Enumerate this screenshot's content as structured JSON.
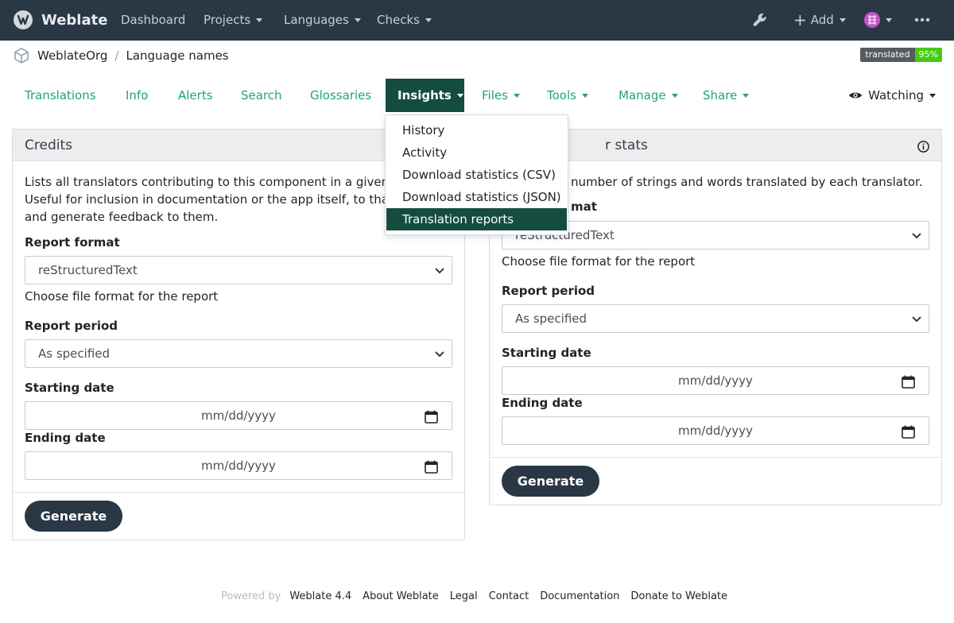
{
  "navbar": {
    "brand": "Weblate",
    "items": [
      {
        "label": "Dashboard"
      },
      {
        "label": "Projects"
      },
      {
        "label": "Languages"
      },
      {
        "label": "Checks"
      }
    ],
    "add_label": "Add"
  },
  "breadcrumb": {
    "project": "WeblateOrg",
    "component": "Language names"
  },
  "badge": {
    "key": "translated",
    "value": "95%"
  },
  "tabs": [
    {
      "label": "Translations"
    },
    {
      "label": "Info"
    },
    {
      "label": "Alerts"
    },
    {
      "label": "Search"
    },
    {
      "label": "Glossaries"
    },
    {
      "label": "Insights"
    },
    {
      "label": "Files"
    },
    {
      "label": "Tools"
    },
    {
      "label": "Manage"
    },
    {
      "label": "Share"
    }
  ],
  "watching_label": "Watching",
  "insights_menu": [
    {
      "label": "History"
    },
    {
      "label": "Activity"
    },
    {
      "label": "Download statistics (CSV)"
    },
    {
      "label": "Download statistics (JSON)"
    },
    {
      "label": "Translation reports"
    }
  ],
  "credits": {
    "title": "Credits",
    "description_lines": [
      "Lists all translators contributing to this component in a given tim",
      "Useful for inclusion in documentation or the app itself, to thank tr",
      "and generate feedback to them."
    ],
    "report_format_label": "Report format",
    "report_format_value": "reStructuredText",
    "report_format_hint": "Choose file format for the report",
    "report_period_label": "Report period",
    "report_period_value": "As specified",
    "starting_date_label": "Starting date",
    "ending_date_label": "Ending date",
    "date_placeholder": "mm/dd/yyyy",
    "generate_label": "Generate"
  },
  "stats": {
    "title_fragment": "r stats",
    "description": "number of strings and words translated by each translator.",
    "report_format_label_fragment": "mat",
    "report_format_value": "reStructuredText",
    "report_format_hint": "Choose file format for the report",
    "report_period_label": "Report period",
    "report_period_value": "As specified",
    "starting_date_label": "Starting date",
    "ending_date_label": "Ending date",
    "date_placeholder": "mm/dd/yyyy",
    "generate_label": "Generate"
  },
  "footer": {
    "powered_by": "Powered by",
    "links": [
      {
        "label": "Weblate 4.4"
      },
      {
        "label": "About Weblate"
      },
      {
        "label": "Legal"
      },
      {
        "label": "Contact"
      },
      {
        "label": "Documentation"
      },
      {
        "label": "Donate to Weblate"
      }
    ]
  }
}
